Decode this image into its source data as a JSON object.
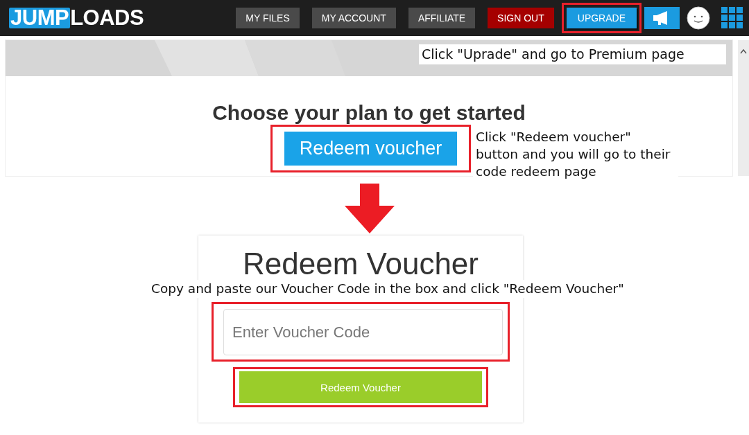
{
  "logo": {
    "mark": "JUMP",
    "rest": "LOADS"
  },
  "nav": [
    {
      "label": "MY FILES",
      "kind": "default",
      "highlighted": false
    },
    {
      "label": "MY ACCOUNT",
      "kind": "default",
      "highlighted": false
    },
    {
      "label": "AFFILIATE",
      "kind": "default",
      "highlighted": false
    },
    {
      "label": "SIGN OUT",
      "kind": "danger",
      "highlighted": false
    },
    {
      "label": "UPGRADE",
      "kind": "primary",
      "highlighted": true
    }
  ],
  "plans": {
    "heading": "Choose your plan to get started",
    "button": {
      "label": "Redeem voucher",
      "highlighted": true
    }
  },
  "voucher": {
    "title": "Redeem Voucher",
    "field": {
      "placeholder": "Enter Voucher Code",
      "highlighted": true
    },
    "button": {
      "label": "Redeem Voucher",
      "highlighted": true
    }
  },
  "annotations": [
    {
      "text": "Click \"Uprade\" and go to Premium page",
      "kind": "top"
    },
    {
      "text": "Click \"Redeem voucher\" button and you will go to their code redeem page",
      "kind": "side"
    },
    {
      "text": "Copy and paste our Voucher Code in the box and click \"Redeem Voucher\"",
      "kind": "wide"
    }
  ]
}
